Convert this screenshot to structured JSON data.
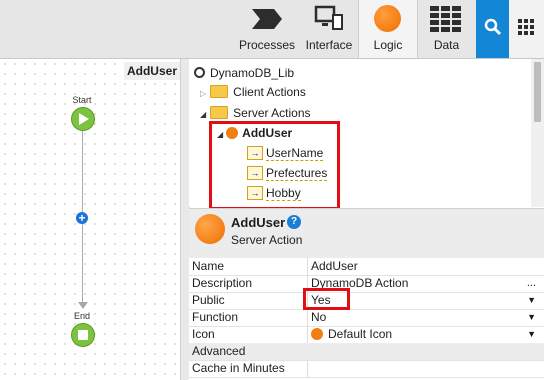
{
  "toolbar": {
    "tabs": [
      {
        "label": "Processes",
        "icon": "processes-chevron-icon",
        "active": false
      },
      {
        "label": "Interface",
        "icon": "interface-monitor-icon",
        "active": false
      },
      {
        "label": "Logic",
        "icon": "logic-orange-circle-icon",
        "active": true
      },
      {
        "label": "Data",
        "icon": "data-table-icon",
        "active": false
      }
    ],
    "search_icon": "search-icon",
    "apps_icon": "grid-icon",
    "accent": "#1387d6"
  },
  "canvas": {
    "title": "AddUser",
    "start_label": "Start",
    "end_label": "End",
    "start_color": "#7cc33f",
    "add_color": "#1a73d9"
  },
  "tree": {
    "root": "DynamoDB_Lib",
    "client_actions": "Client Actions",
    "server_actions": "Server Actions",
    "action": "AddUser",
    "params": [
      "UserName",
      "Prefectures",
      "Hobby"
    ]
  },
  "properties": {
    "title": "AddUser",
    "subtitle": "Server Action",
    "rows": [
      {
        "name": "Name",
        "value": "AddUser",
        "dropdown": false
      },
      {
        "name": "Description",
        "value": "DynamoDB Action",
        "dropdown": false,
        "ellipsis": "..."
      },
      {
        "name": "Public",
        "value": "Yes",
        "dropdown": true
      },
      {
        "name": "Function",
        "value": "No",
        "dropdown": true
      },
      {
        "name": "Icon",
        "value": "Default Icon",
        "dropdown": true
      }
    ],
    "section": "Advanced",
    "cache_label": "Cache in Minutes"
  },
  "highlight_color": "#e10e14"
}
